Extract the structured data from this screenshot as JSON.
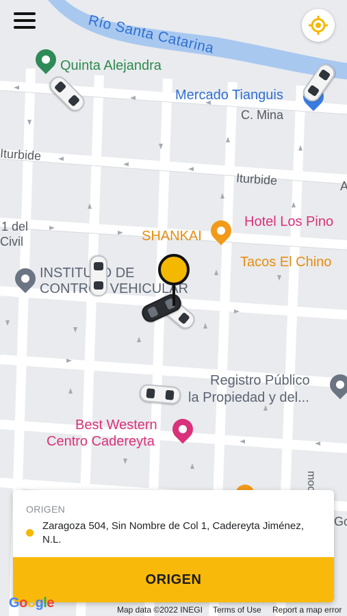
{
  "map": {
    "river_label": "Río Santa Catarina",
    "streets": [
      "C. Mina",
      "Iturbide",
      "Iturbide",
      "A",
      "1 del",
      "Civil",
      "moc",
      "Go"
    ],
    "pois": {
      "park": "Quinta Alejandra",
      "market": "Mercado Tianguis",
      "restaurant": "SHANKAI",
      "hotel": "Hotel Los Pino",
      "tacos": "Tacos El Chino",
      "institute_line1": "INSTITUTO DE",
      "institute_line2": "CONTROL VEHICULAR",
      "registry_line1": "Registro Público",
      "registry_line2": "la Propiedad y del...",
      "best_western_line1": "Best Western",
      "best_western_line2": "Centro Cadereyta"
    },
    "colors": {
      "road": "#ffffff",
      "block": "#e9ebee",
      "river": "#a8c8f0",
      "accent": "#f5b800"
    }
  },
  "card": {
    "title": "ORIGEN",
    "address": "Zaragoza 504, Sin Nombre de Col 1, Cadereyta Jiménez, N.L.",
    "button_label": "ORIGEN"
  },
  "footer": {
    "logo": [
      "G",
      "o",
      "o",
      "g",
      "l",
      "e"
    ],
    "map_data": "Map data ©2022 INEGI",
    "terms": "Terms of Use",
    "report": "Report a map error"
  },
  "icons": {
    "menu": "hamburger-menu-icon",
    "locate": "crosshair-locate-icon",
    "park": "tree-pin-icon",
    "market": "shopping-bag-pin-icon",
    "restaurant": "fork-knife-icon",
    "institute": "government-building-icon",
    "hotel": "bed-pin-icon"
  }
}
